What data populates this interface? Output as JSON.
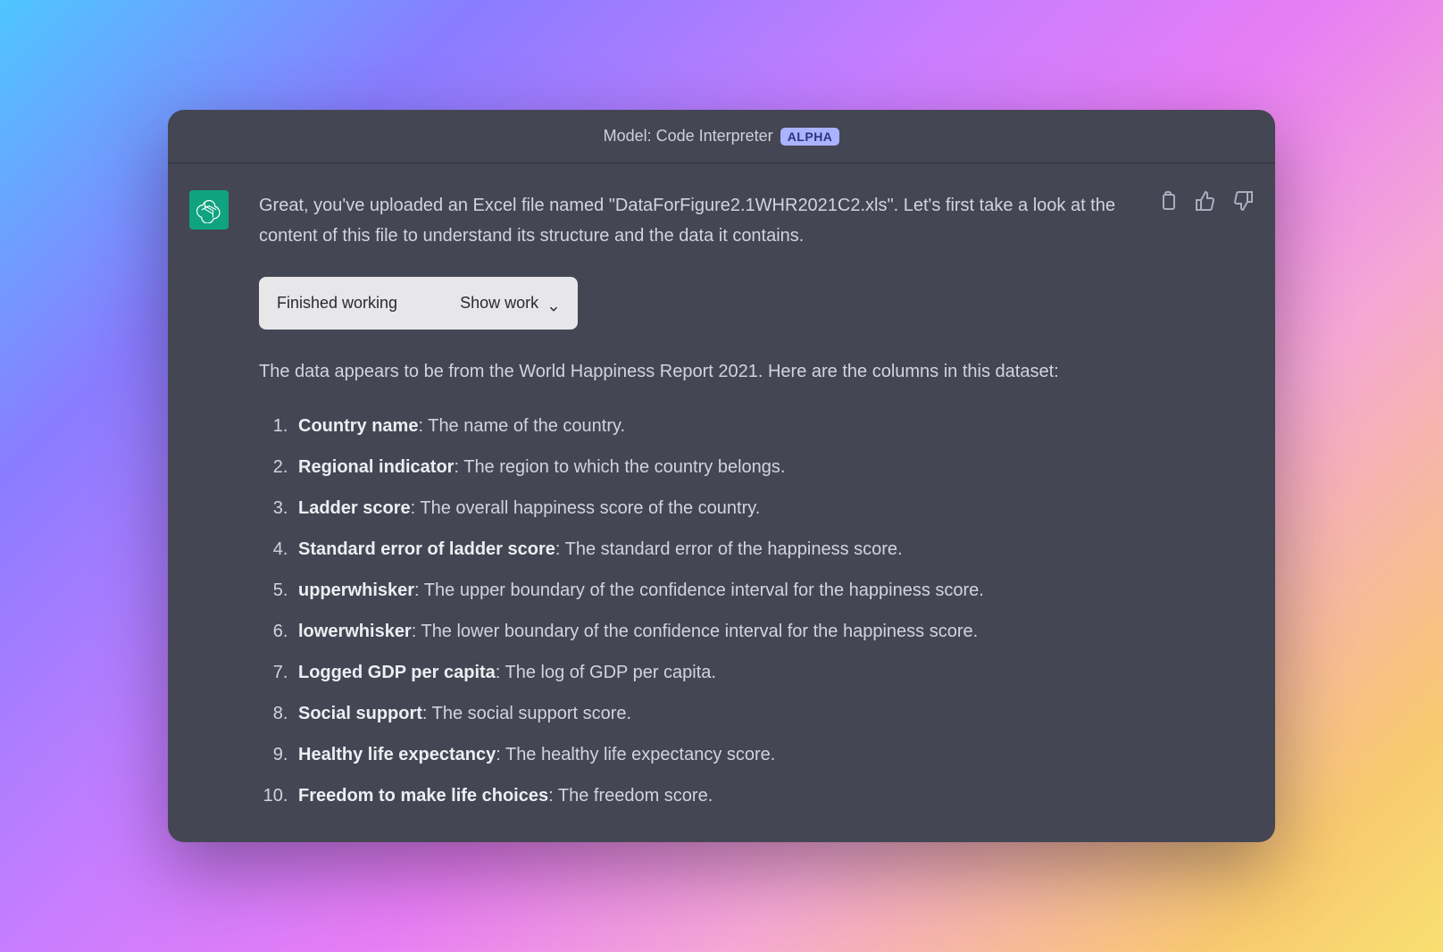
{
  "model_bar": {
    "label": "Model: Code Interpreter",
    "badge": "ALPHA"
  },
  "message": {
    "intro": "Great, you've uploaded an Excel file named \"DataForFigure2.1WHR2021C2.xls\". Let's first take a look at the content of this file to understand its structure and the data it contains.",
    "expander": {
      "status": "Finished working",
      "action": "Show work"
    },
    "after": "The data appears to be from the World Happiness Report 2021. Here are the columns in this dataset:",
    "columns": [
      {
        "name": "Country name",
        "desc": ": The name of the country."
      },
      {
        "name": "Regional indicator",
        "desc": ": The region to which the country belongs."
      },
      {
        "name": "Ladder score",
        "desc": ": The overall happiness score of the country."
      },
      {
        "name": "Standard error of ladder score",
        "desc": ": The standard error of the happiness score."
      },
      {
        "name": "upperwhisker",
        "desc": ": The upper boundary of the confidence interval for the happiness score."
      },
      {
        "name": "lowerwhisker",
        "desc": ": The lower boundary of the confidence interval for the happiness score."
      },
      {
        "name": "Logged GDP per capita",
        "desc": ": The log of GDP per capita."
      },
      {
        "name": "Social support",
        "desc": ": The social support score."
      },
      {
        "name": "Healthy life expectancy",
        "desc": ": The healthy life expectancy score."
      },
      {
        "name": "Freedom to make life choices",
        "desc": ": The freedom score."
      }
    ]
  }
}
